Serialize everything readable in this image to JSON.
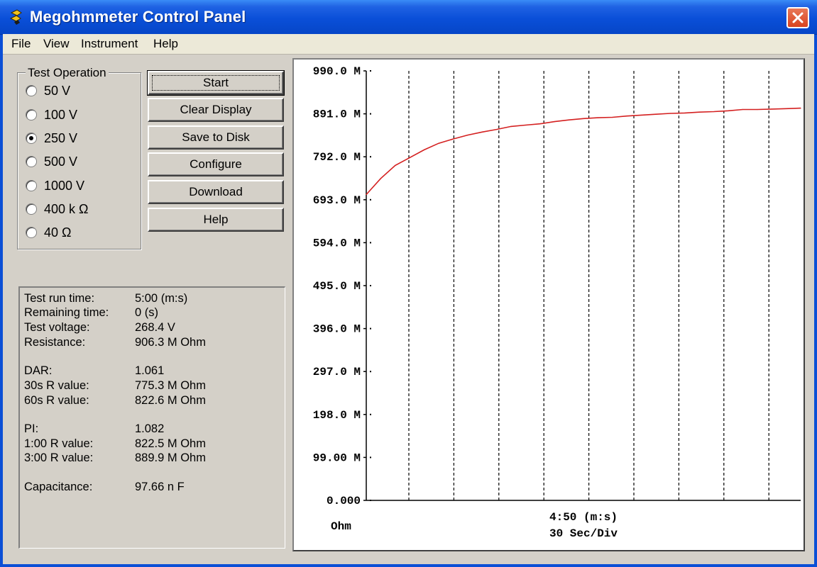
{
  "window": {
    "title": "Megohmmeter Control Panel"
  },
  "menu": [
    "File",
    "View",
    "Instrument",
    "Help"
  ],
  "test_operation": {
    "legend": "Test Operation",
    "options": [
      "50 V",
      "100 V",
      "250 V",
      "500 V",
      "1000 V",
      "400 k Ω",
      "40 Ω"
    ],
    "selected": "250 V"
  },
  "buttons": {
    "start": "Start",
    "clear_display": "Clear Display",
    "save_to_disk": "Save to Disk",
    "configure": "Configure",
    "download": "Download",
    "help": "Help"
  },
  "results": [
    {
      "label": "Test run time:",
      "value": "5:00 (m:s)"
    },
    {
      "label": "Remaining time:",
      "value": "0 (s)"
    },
    {
      "label": "Test voltage:",
      "value": "268.4  V"
    },
    {
      "label": "Resistance:",
      "value": "906.3 M Ohm"
    },
    {
      "label": "DAR:",
      "value": "1.061"
    },
    {
      "label": "30s R value:",
      "value": "775.3 M Ohm"
    },
    {
      "label": "60s R value:",
      "value": "822.6 M Ohm"
    },
    {
      "label": "PI:",
      "value": "1.082"
    },
    {
      "label": "1:00 R value:",
      "value": "822.5 M Ohm"
    },
    {
      "label": "3:00 R value:",
      "value": "889.9 M Ohm"
    },
    {
      "label": "Capacitance:",
      "value": "97.66 n F"
    }
  ],
  "chart_data": {
    "type": "line",
    "y_tick_labels": [
      "990.0 M",
      "891.0 M",
      "792.0 M",
      "693.0 M",
      "594.0 M",
      "495.0 M",
      "396.0 M",
      "297.0 M",
      "198.0 M",
      "99.00 M",
      "0.000"
    ],
    "y_unit_label": "Ohm",
    "ylim": [
      0,
      990
    ],
    "x_time_label": "4:50 (m:s)",
    "x_scale_label": "30 Sec/Div",
    "x_divisions": 10,
    "grid": "vertical dashed",
    "line_color": "#d42020",
    "series": [
      {
        "x": [
          0,
          10,
          20,
          30,
          40,
          50,
          60,
          70,
          80,
          90,
          100,
          110,
          120,
          130,
          140,
          150,
          160,
          170,
          180,
          190,
          200,
          210,
          220,
          230,
          240,
          250,
          260,
          270,
          280,
          290,
          300
        ],
        "values": [
          705,
          742,
          772,
          790,
          808,
          823,
          833,
          842,
          849,
          855,
          862,
          865,
          868,
          873,
          877,
          880,
          882,
          883,
          886,
          888,
          890,
          892,
          893,
          895,
          896,
          898,
          901,
          901,
          902,
          903,
          904
        ]
      }
    ]
  }
}
